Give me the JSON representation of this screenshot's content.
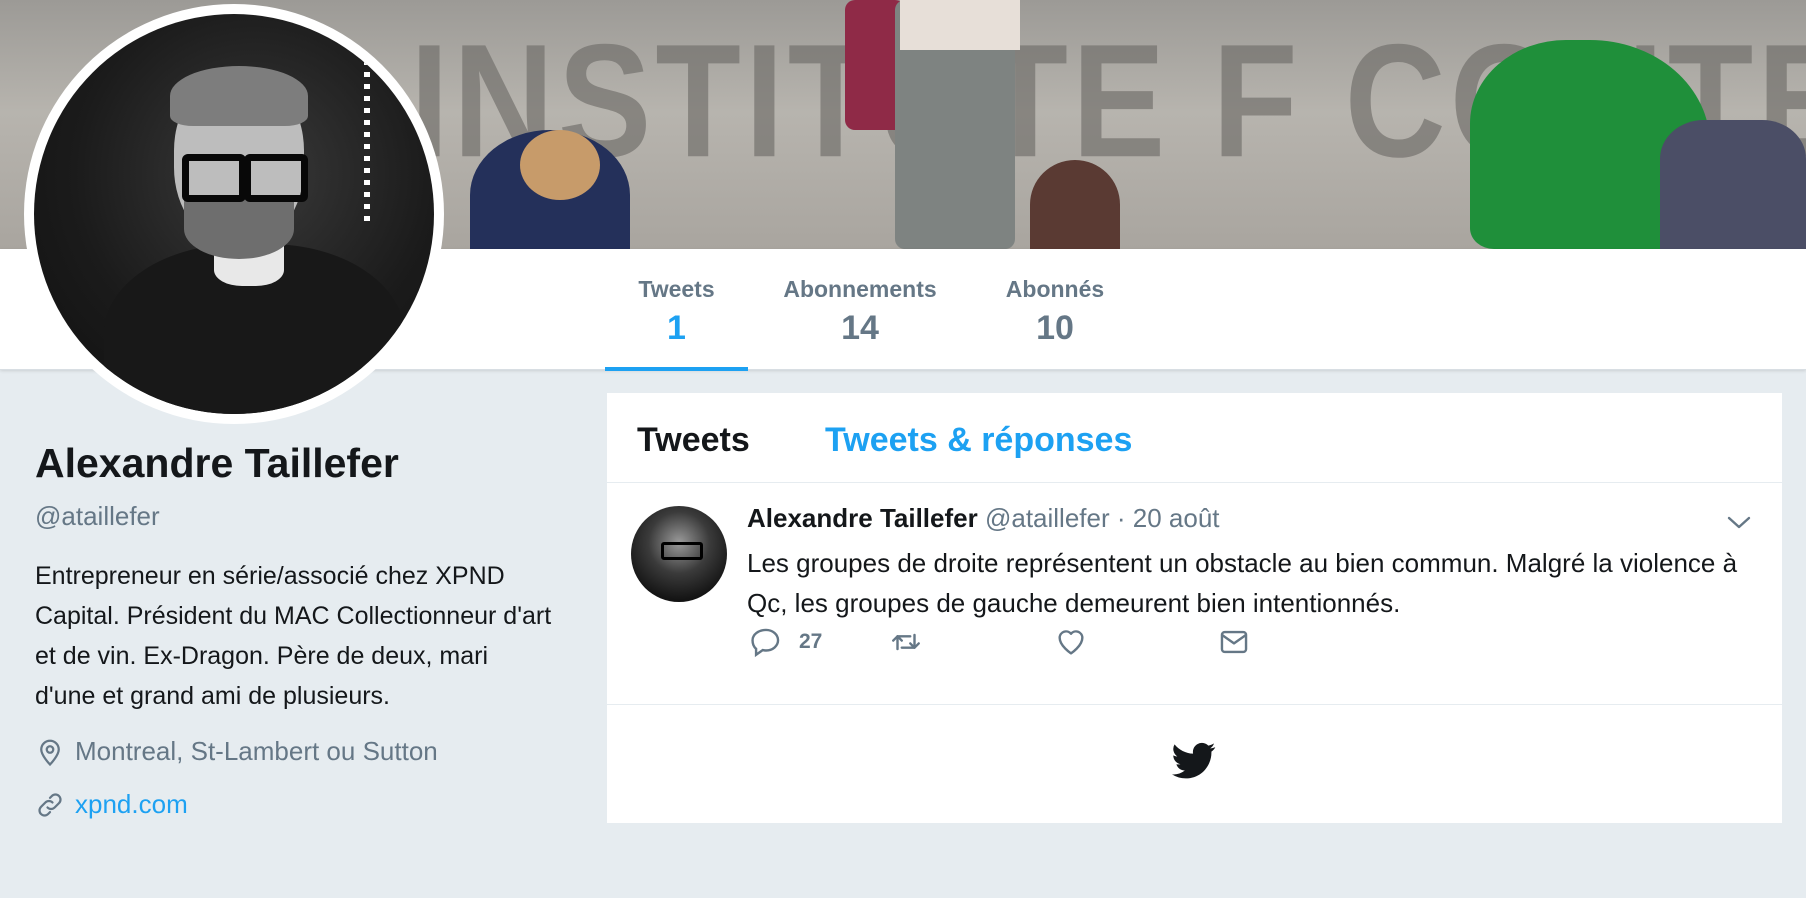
{
  "profile": {
    "name": "Alexandre Taillefer",
    "handle": "@ataillefer",
    "bio": "Entrepreneur en série/associé chez XPND Capital. Président du MAC Collectionneur d'art et de vin. Ex-Dragon. Père de deux, mari d'une et grand ami de plusieurs.",
    "location": "Montreal, St-Lambert ou Sutton",
    "website": "xpnd.com"
  },
  "stats": [
    {
      "label": "Tweets",
      "value": "1"
    },
    {
      "label": "Abonnements",
      "value": "14"
    },
    {
      "label": "Abonnés",
      "value": "10"
    }
  ],
  "timeline": {
    "tabs": [
      "Tweets",
      "Tweets & réponses"
    ],
    "tweet": {
      "author": "Alexandre Taillefer",
      "handle": "@ataillefer",
      "date": "· 20 août",
      "text": "Les groupes de droite représentent un obstacle au bien commun. Malgré la violence à Qc, les groupes de gauche demeurent bien intentionnés.",
      "reply_count": "27"
    }
  },
  "colors": {
    "accent": "#1da1f2",
    "muted": "#657786",
    "background": "#e6ecf0"
  },
  "icons": [
    "location-pin-icon",
    "link-icon",
    "reply-icon",
    "retweet-icon",
    "like-icon",
    "direct-message-icon",
    "chevron-down-icon",
    "twitter-bird-icon"
  ]
}
